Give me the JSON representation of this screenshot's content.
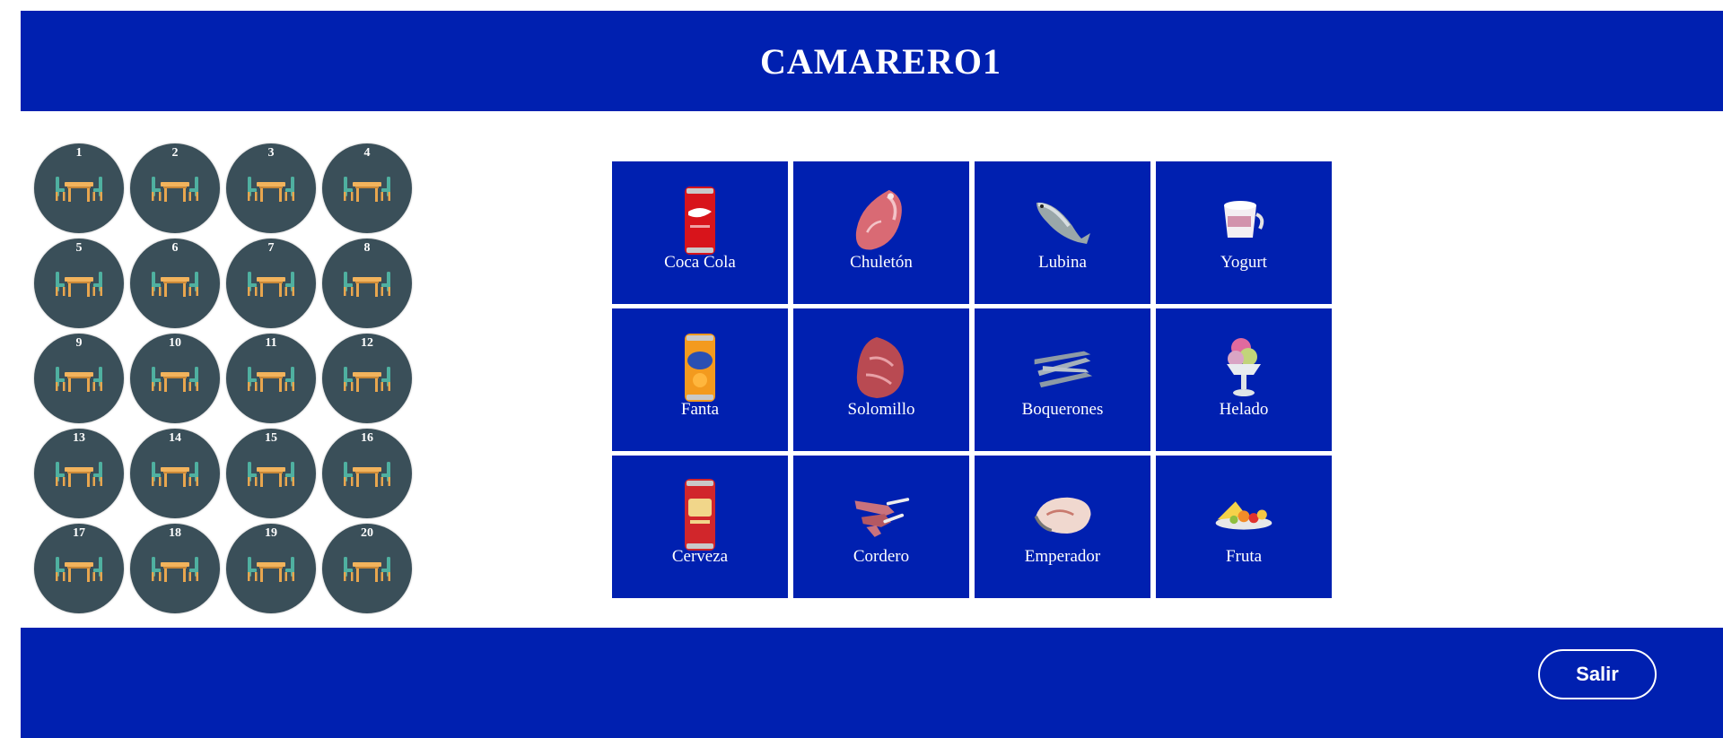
{
  "header": {
    "title": "CAMARERO1"
  },
  "colors": {
    "brand_blue": "#0020b0",
    "table_circle": "#3a4f59",
    "table_wood": "#e8a64e",
    "chair": "#4fb0a0"
  },
  "tables": [
    {
      "num": "1"
    },
    {
      "num": "2"
    },
    {
      "num": "3"
    },
    {
      "num": "4"
    },
    {
      "num": "5"
    },
    {
      "num": "6"
    },
    {
      "num": "7"
    },
    {
      "num": "8"
    },
    {
      "num": "9"
    },
    {
      "num": "10"
    },
    {
      "num": "11"
    },
    {
      "num": "12"
    },
    {
      "num": "13"
    },
    {
      "num": "14"
    },
    {
      "num": "15"
    },
    {
      "num": "16"
    },
    {
      "num": "17"
    },
    {
      "num": "18"
    },
    {
      "num": "19"
    },
    {
      "num": "20"
    }
  ],
  "products": [
    {
      "label": "Coca Cola",
      "icon": "cola-can-icon"
    },
    {
      "label": "Chuletón",
      "icon": "steak-icon"
    },
    {
      "label": "Lubina",
      "icon": "fish-icon"
    },
    {
      "label": "Yogurt",
      "icon": "yogurt-cup-icon"
    },
    {
      "label": "Fanta",
      "icon": "fanta-can-icon"
    },
    {
      "label": "Solomillo",
      "icon": "sirloin-icon"
    },
    {
      "label": "Boquerones",
      "icon": "anchovies-icon"
    },
    {
      "label": "Helado",
      "icon": "ice-cream-icon"
    },
    {
      "label": "Cerveza",
      "icon": "beer-can-icon"
    },
    {
      "label": "Cordero",
      "icon": "lamb-ribs-icon"
    },
    {
      "label": "Emperador",
      "icon": "swordfish-steak-icon"
    },
    {
      "label": "Fruta",
      "icon": "fruit-plate-icon"
    }
  ],
  "footer": {
    "exit_label": "Salir"
  }
}
